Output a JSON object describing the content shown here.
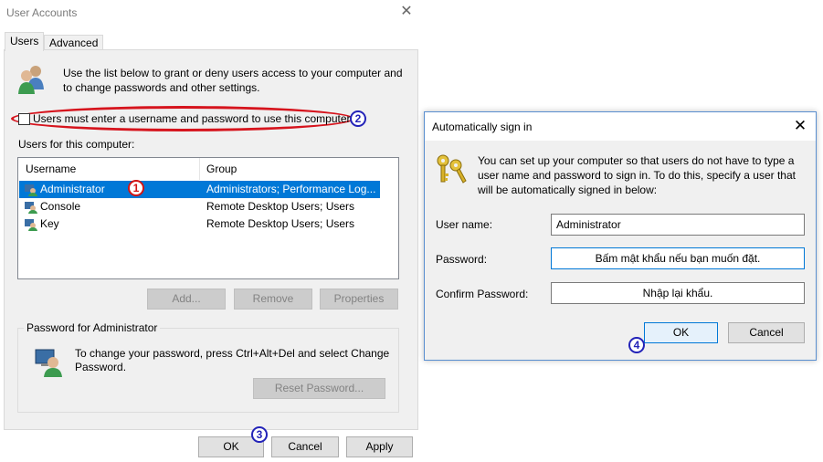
{
  "user_accounts": {
    "title": "User Accounts",
    "close": "✕",
    "tabs": [
      {
        "label": "Users"
      },
      {
        "label": "Advanced"
      }
    ],
    "intro": "Use the list below to grant or deny users access to your computer and to change passwords and other settings.",
    "must_login_label": "Users must enter a username and password to use this computer.",
    "users_label": "Users for this computer:",
    "columns": [
      "Username",
      "Group"
    ],
    "users": [
      {
        "name": "Administrator",
        "group": "Administrators; Performance Log..."
      },
      {
        "name": "Console",
        "group": "Remote Desktop Users; Users"
      },
      {
        "name": "Key",
        "group": "Remote Desktop Users; Users"
      }
    ],
    "buttons": {
      "add": "Add...",
      "remove": "Remove",
      "properties": "Properties"
    },
    "password_group": {
      "title": "Password for Administrator",
      "text": "To change your password, press Ctrl+Alt+Del and select Change Password.",
      "reset": "Reset Password..."
    },
    "footer": {
      "ok": "OK",
      "cancel": "Cancel",
      "apply": "Apply"
    }
  },
  "auto_sign_in": {
    "title": "Automatically sign in",
    "close": "✕",
    "intro": "You can set up your computer so that users do not have to type a user name and password to sign in. To do this, specify a user that will be automatically signed in below:",
    "fields": {
      "username_label": "User name:",
      "username_value": "Administrator",
      "password_label": "Password:",
      "password_value": "Bấm mật khẩu nếu bạn muốn đặt.",
      "confirm_label": "Confirm Password:",
      "confirm_value": "Nhập lại khẩu."
    },
    "buttons": {
      "ok": "OK",
      "cancel": "Cancel"
    }
  },
  "badges": [
    "1",
    "2",
    "3",
    "4"
  ],
  "colors": {
    "selection": "#0078d7",
    "highlight_oval": "#d6141d",
    "badge_blue": "#2323b8",
    "badge_red": "#d21414"
  }
}
